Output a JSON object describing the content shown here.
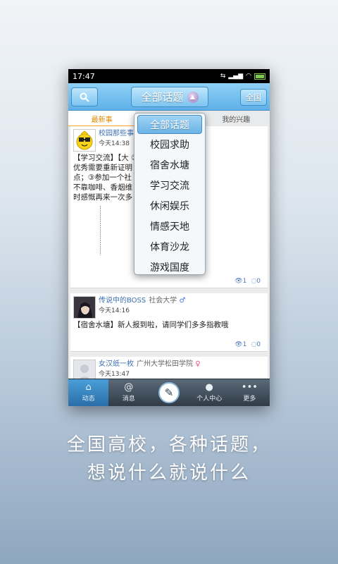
{
  "status_bar": {
    "time": "17:47"
  },
  "header": {
    "title": "全部话题",
    "right_button": "全国"
  },
  "tabs": [
    {
      "label": "最新事"
    },
    {
      "label": ""
    },
    {
      "label": "我的兴趣"
    }
  ],
  "dropdown": {
    "items": [
      "全部话题",
      "校园求助",
      "宿舍水塘",
      "学习交流",
      "休闲娱乐",
      "情感天地",
      "体育沙龙",
      "游戏国度"
    ]
  },
  "posts": [
    {
      "name": "校园那些事",
      "school": "",
      "gender": "",
      "time": "今天14:38",
      "text": "【学习交流】【大      ①忘掉高考分数，\n优秀需要重新证明      己每天进步一点\n点；③参加一个社      ；④坚持锻炼，\n不靠咖啡、香烟维      阅读；⑤与其离开\n时感慨再来一次多      好好把握。",
      "views": "1",
      "comments": "0"
    },
    {
      "name": "传说中的BOSS",
      "school": "社会大学",
      "gender": "♂",
      "time": "今天14:16",
      "text": "【宿舍水塘】新人报到啦，请同学们多多指教哦",
      "views": "1",
      "comments": "0"
    },
    {
      "name": "女汉纸一枚",
      "school": "广州大学松田学院",
      "gender": "♀",
      "time": "今天13:47",
      "text": "",
      "views": "",
      "comments": ""
    }
  ],
  "bottom_nav": [
    {
      "label": "动态",
      "icon": "home-icon"
    },
    {
      "label": "消息",
      "icon": "at-icon"
    },
    {
      "label": "",
      "icon": "compose-icon"
    },
    {
      "label": "个人中心",
      "icon": "person-icon"
    },
    {
      "label": "更多",
      "icon": "more-icon"
    }
  ],
  "caption": {
    "line1": "全国高校，各种话题，",
    "line2": "想说什么就说什么"
  }
}
